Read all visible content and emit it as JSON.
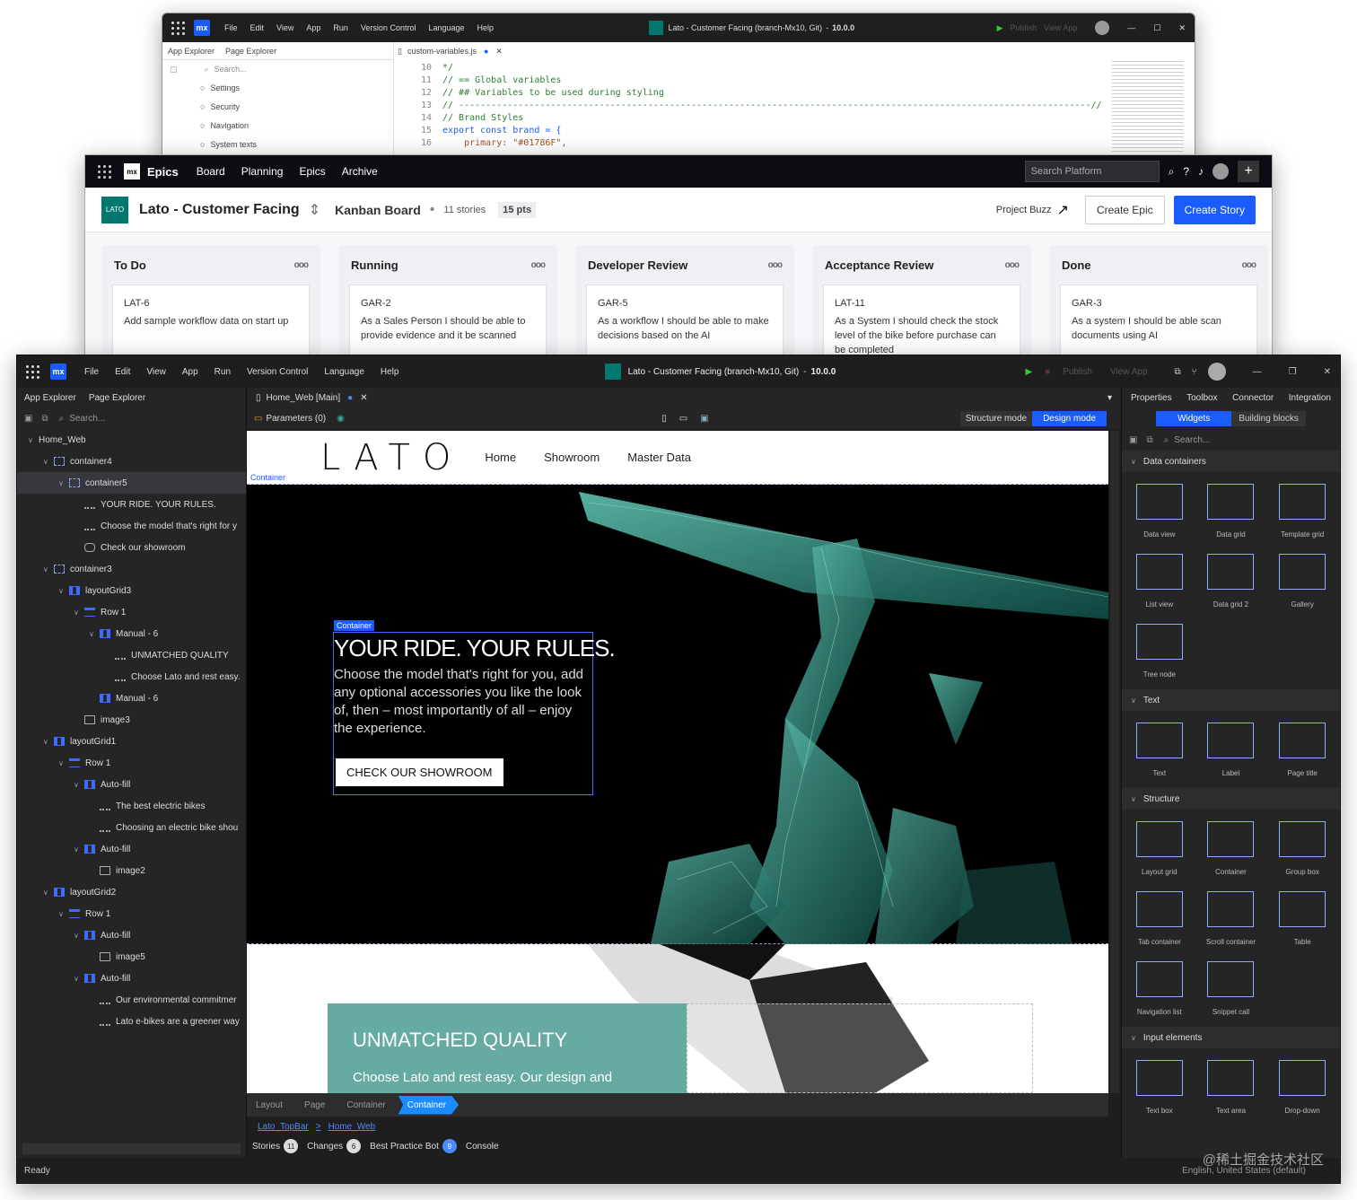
{
  "w1": {
    "menu": [
      "File",
      "Edit",
      "View",
      "App",
      "Run",
      "Version Control",
      "Language",
      "Help"
    ],
    "title": "Lato - Customer Facing (branch-Mx10, Git)",
    "version": "10.0.0",
    "publish": "Publish",
    "view_app": "View App",
    "left_tabs": [
      "App Explorer",
      "Page Explorer"
    ],
    "search": "Search...",
    "tree": [
      "Settings",
      "Security",
      "Navigation",
      "System texts"
    ],
    "file_tab": "custom-variables.js",
    "code_lines": [
      {
        "n": "10",
        "t": "*/",
        "cls": "c-com"
      },
      {
        "n": "11",
        "t": "// == Global variables",
        "cls": "c-com"
      },
      {
        "n": "12",
        "t": "// ## Variables to be used during styling",
        "cls": "c-com"
      },
      {
        "n": "13",
        "t": "// ---------------------------------------------------------------------------------------------------------------------//",
        "cls": "c-com"
      },
      {
        "n": "14",
        "t": "// Brand Styles",
        "cls": "c-com"
      },
      {
        "n": "15",
        "t": "export const brand = {",
        "cls": "c-kw"
      },
      {
        "n": "16",
        "t": "    primary: \"#01786F\",",
        "cls": "c-str"
      }
    ]
  },
  "w2": {
    "app": "Epics",
    "nav": [
      "Board",
      "Planning",
      "Epics",
      "Archive"
    ],
    "search": "Search Platform",
    "logo": "LATO",
    "project": "Lato - Customer Facing",
    "board": "Kanban Board",
    "stories": "11 stories",
    "points": "15 pts",
    "buzz": "Project Buzz",
    "create_epic": "Create Epic",
    "create_story": "Create Story",
    "more": "ooo",
    "columns": [
      {
        "title": "To Do",
        "id": "LAT-6",
        "text": "Add sample workflow data on start up"
      },
      {
        "title": "Running",
        "id": "GAR-2",
        "text": "As a Sales Person I should be able to provide evidence and it be scanned"
      },
      {
        "title": "Developer Review",
        "id": "GAR-5",
        "text": "As a workflow I should be able to make decisions based on the AI"
      },
      {
        "title": "Acceptance Review",
        "id": "LAT-11",
        "text": "As a System I should check the stock level of the bike before purchase can be completed"
      },
      {
        "title": "Done",
        "id": "GAR-3",
        "text": "As a system I should be able scan documents using AI"
      }
    ]
  },
  "w3": {
    "menu": [
      "File",
      "Edit",
      "View",
      "App",
      "Run",
      "Version Control",
      "Language",
      "Help"
    ],
    "title": "Lato - Customer Facing (branch-Mx10, Git)",
    "version": "10.0.0",
    "publish": "Publish",
    "view_app": "View App",
    "left_tabs": [
      "App Explorer",
      "Page Explorer"
    ],
    "search": "Search...",
    "tree": [
      {
        "l": "Home_Web",
        "d": 0,
        "ic": "",
        "c": "v"
      },
      {
        "l": "container4",
        "d": 1,
        "ic": "ic-cont",
        "c": "v"
      },
      {
        "l": "container5",
        "d": 2,
        "ic": "ic-cont",
        "c": "v",
        "sel": true
      },
      {
        "l": "YOUR RIDE. YOUR RULES.",
        "d": 3,
        "ic": "ic-text",
        "c": ""
      },
      {
        "l": "Choose the model that's right for y",
        "d": 3,
        "ic": "ic-text",
        "c": ""
      },
      {
        "l": "Check our showroom",
        "d": 3,
        "ic": "ic-btn",
        "c": ""
      },
      {
        "l": "container3",
        "d": 1,
        "ic": "ic-cont",
        "c": "v"
      },
      {
        "l": "layoutGrid3",
        "d": 2,
        "ic": "ic-grid",
        "c": "v"
      },
      {
        "l": "Row 1",
        "d": 3,
        "ic": "ic-row",
        "c": "v"
      },
      {
        "l": "Manual - 6",
        "d": 4,
        "ic": "ic-grid",
        "c": "v"
      },
      {
        "l": "UNMATCHED QUALITY",
        "d": 5,
        "ic": "ic-text",
        "c": ""
      },
      {
        "l": "Choose Lato and rest easy.",
        "d": 5,
        "ic": "ic-text",
        "c": ""
      },
      {
        "l": "Manual - 6",
        "d": 4,
        "ic": "ic-grid",
        "c": ""
      },
      {
        "l": "image3",
        "d": 3,
        "ic": "ic-img",
        "c": ""
      },
      {
        "l": "layoutGrid1",
        "d": 1,
        "ic": "ic-grid",
        "c": "v"
      },
      {
        "l": "Row 1",
        "d": 2,
        "ic": "ic-row",
        "c": "v"
      },
      {
        "l": "Auto-fill",
        "d": 3,
        "ic": "ic-grid",
        "c": "v"
      },
      {
        "l": "The best electric bikes",
        "d": 4,
        "ic": "ic-text",
        "c": ""
      },
      {
        "l": "Choosing an electric bike shou",
        "d": 4,
        "ic": "ic-text",
        "c": ""
      },
      {
        "l": "Auto-fill",
        "d": 3,
        "ic": "ic-grid",
        "c": "v"
      },
      {
        "l": "image2",
        "d": 4,
        "ic": "ic-img",
        "c": ""
      },
      {
        "l": "layoutGrid2",
        "d": 1,
        "ic": "ic-grid",
        "c": "v"
      },
      {
        "l": "Row 1",
        "d": 2,
        "ic": "ic-row",
        "c": "v"
      },
      {
        "l": "Auto-fill",
        "d": 3,
        "ic": "ic-grid",
        "c": "v"
      },
      {
        "l": "image5",
        "d": 4,
        "ic": "ic-img",
        "c": ""
      },
      {
        "l": "Auto-fill",
        "d": 3,
        "ic": "ic-grid",
        "c": "v"
      },
      {
        "l": "Our environmental commitmer",
        "d": 4,
        "ic": "ic-text",
        "c": ""
      },
      {
        "l": "Lato e-bikes are a greener way",
        "d": 4,
        "ic": "ic-text",
        "c": ""
      }
    ],
    "doc_tab": "Home_Web [Main]",
    "params": "Parameters (0)",
    "structure_mode": "Structure mode",
    "design_mode": "Design mode",
    "page": {
      "logo": "LATO",
      "nav": [
        "Home",
        "Showroom",
        "Master Data"
      ],
      "container_tag": "Container",
      "hero_title": "YOUR RIDE. YOUR RULES.",
      "hero_text": "Choose the model that's right for you, add any optional accessories you like the look of, then – most importantly of all – enjoy the experience.",
      "hero_btn": "CHECK OUR SHOWROOM",
      "q_title": "UNMATCHED QUALITY",
      "q_text": "Choose Lato and rest easy. Our design and"
    },
    "crumbs": [
      "Layout",
      "Page",
      "Container",
      "Container"
    ],
    "path": [
      "Lato_TopBar",
      ">",
      "Home_Web"
    ],
    "status_tabs": [
      {
        "l": "Stories",
        "b": "11"
      },
      {
        "l": "Changes",
        "b": "6"
      },
      {
        "l": "Best Practice Bot",
        "b": "9"
      },
      {
        "l": "Console",
        "b": ""
      }
    ],
    "ready": "Ready",
    "locale": "English, United States (default)",
    "right_tabs": [
      "Properties",
      "Toolbox",
      "Connector",
      "Integration"
    ],
    "sub_tabs": [
      "Widgets",
      "Building blocks"
    ],
    "sections": [
      {
        "t": "Data containers",
        "items": [
          "Data view",
          "Data grid",
          "Template grid",
          "List view",
          "Data grid 2",
          "Gallery",
          "Tree node"
        ]
      },
      {
        "t": "Text",
        "items": [
          "Text",
          "Label",
          "Page title"
        ]
      },
      {
        "t": "Structure",
        "items": [
          "Layout grid",
          "Container",
          "Group box",
          "Tab container",
          "Scroll container",
          "Table",
          "Navigation list",
          "Snippet call"
        ]
      },
      {
        "t": "Input elements",
        "items": [
          "Text box",
          "Text area",
          "Drop-down"
        ]
      }
    ],
    "watermark": "@稀土掘金技术社区"
  }
}
